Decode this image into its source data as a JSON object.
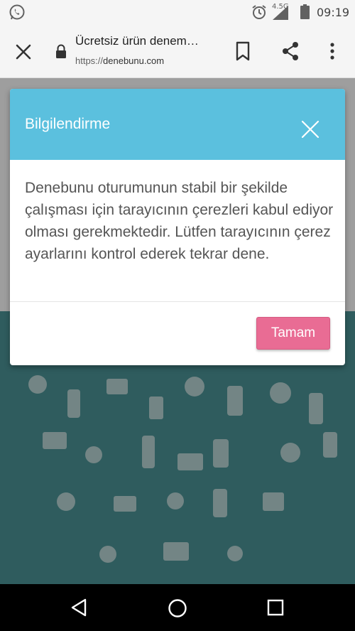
{
  "status_bar": {
    "network": "4.5G",
    "time": "09:19",
    "icons": [
      "whatsapp-icon",
      "alarm-icon",
      "signal-icon",
      "battery-icon"
    ]
  },
  "browser": {
    "page_title": "Ücretsiz ürün denem…",
    "url_scheme": "https://",
    "url_host": "denebunu.com",
    "icons": [
      "close-icon",
      "lock-icon",
      "bookmark-icon",
      "share-icon",
      "more-vert-icon"
    ]
  },
  "modal": {
    "title": "Bilgilendirme",
    "body": "Denebunu oturumunun stabil bir şekilde çalışması için tarayıcının çerezleri kabul ediyor olması gerekmektedir. Lütfen tarayıcının çerez ayarlarını kontrol ederek tekrar dene.",
    "ok_label": "Tamam"
  },
  "navbar": {
    "icons": [
      "back-icon",
      "home-icon",
      "recent-apps-icon"
    ]
  },
  "colors": {
    "modal_header": "#5bc0de",
    "ok_button": "#e96c94",
    "page_dim": "#9e9e9e",
    "teal_section": "#2f5c5e"
  }
}
